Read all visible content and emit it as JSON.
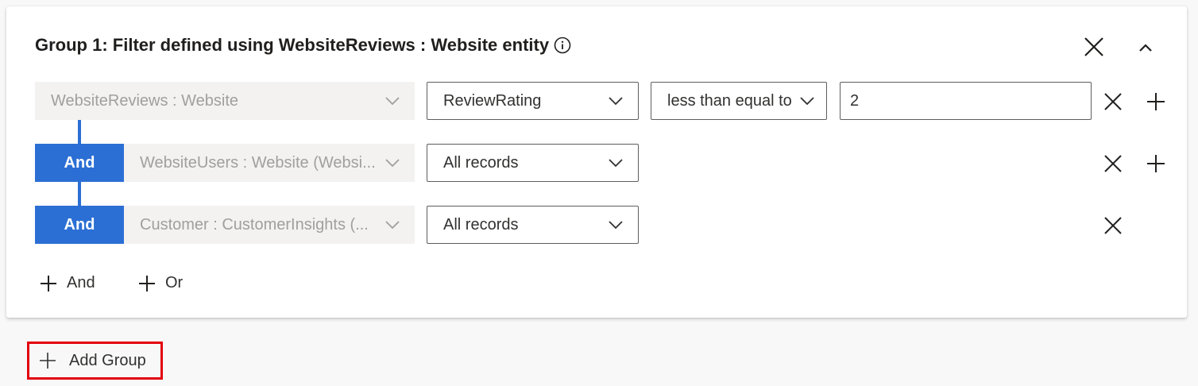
{
  "group": {
    "title": "Group 1: Filter defined using WebsiteReviews : Website entity"
  },
  "rows": [
    {
      "entity": "WebsiteReviews : Website",
      "field": "ReviewRating",
      "operator": "less than equal to",
      "value": "2"
    },
    {
      "connector": "And",
      "entity": "WebsiteUsers : Website (Websi...",
      "field": "All records"
    },
    {
      "connector": "And",
      "entity": "Customer : CustomerInsights (...",
      "field": "All records"
    }
  ],
  "actions": {
    "add_and": "And",
    "add_or": "Or",
    "add_group": "Add Group"
  },
  "colors": {
    "accent": "#2b6fd4",
    "highlight_border": "#e3000f"
  }
}
